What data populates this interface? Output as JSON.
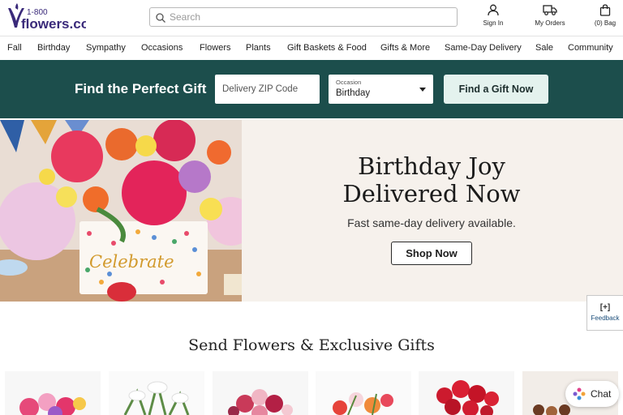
{
  "brand": {
    "logo_text_top": "1-800",
    "logo_text_main": "flowers.com"
  },
  "search": {
    "placeholder": "Search"
  },
  "header_actions": {
    "sign_in": "Sign In",
    "my_orders": "My Orders",
    "bag": "(0) Bag"
  },
  "nav": {
    "items": [
      "Fall",
      "Birthday",
      "Sympathy",
      "Occasions",
      "Flowers",
      "Plants",
      "Gift Baskets & Food",
      "Gifts & More",
      "Same-Day Delivery",
      "Sale",
      "Community"
    ]
  },
  "finder": {
    "title": "Find the Perfect Gift",
    "zip_placeholder": "Delivery ZIP Code",
    "occasion_label": "Occasion",
    "occasion_value": "Birthday",
    "button": "Find a Gift Now"
  },
  "hero": {
    "title_line1": "Birthday Joy",
    "title_line2": "Delivered Now",
    "subtitle": "Fast same-day delivery available.",
    "button": "Shop Now",
    "vase_text": "Celebrate"
  },
  "feedback": {
    "plus": "[+]",
    "label": "Feedback"
  },
  "section": {
    "title": "Send Flowers & Exclusive Gifts"
  },
  "chat": {
    "label": "Chat"
  },
  "colors": {
    "brand_teal": "#1c4e4c",
    "button_mint": "#e4f2ee",
    "brand_purple": "#3a2a7a"
  }
}
